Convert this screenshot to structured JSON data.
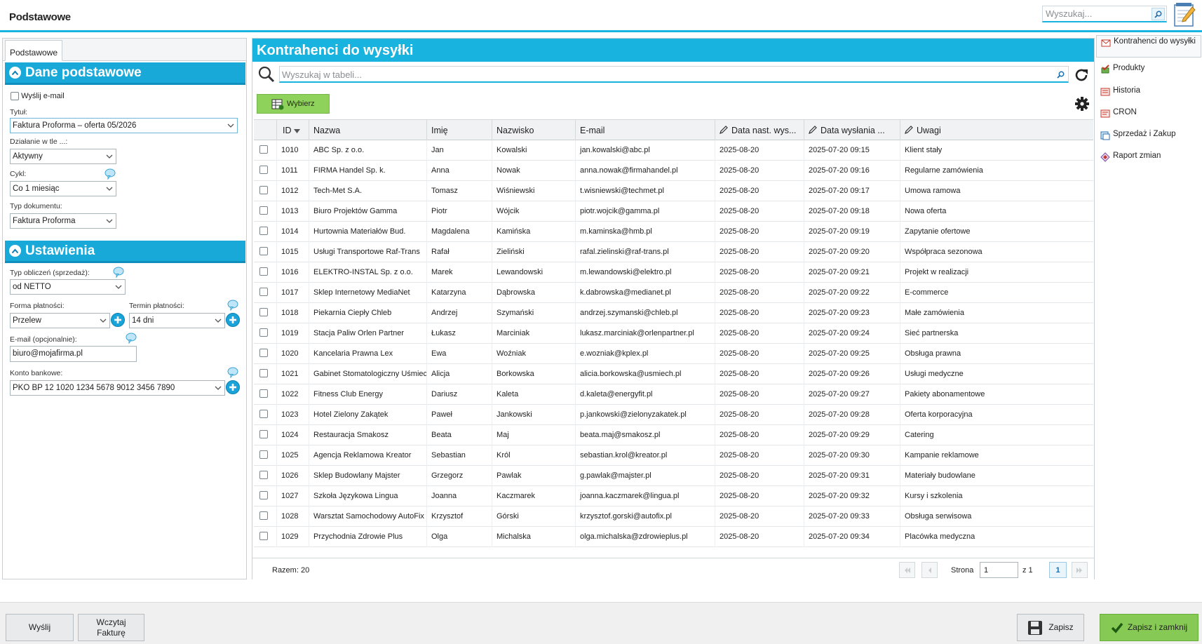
{
  "app": {
    "title": "Podstawowe"
  },
  "global_search": {
    "placeholder": "Wyszukaj..."
  },
  "left_panel": {
    "tab": "Podstawowe",
    "sections": {
      "basic": "Dane podstawowe",
      "settings": "Ustawienia"
    },
    "send_email_label": "Wyślij e-mail",
    "title_label": "Tytuł:",
    "title_value": "Faktura Proforma – oferta 05/2026",
    "background_label": "Działanie w tle ...:",
    "background_value": "Aktywny",
    "cycle_label": "Cykl:",
    "cycle_value": "Co 1 miesiąc",
    "doc_type_label": "Typ dokumentu:",
    "doc_type_value": "Faktura Proforma",
    "calc_type_label": "Typ obliczeń (sprzedaż):",
    "calc_type_value": "od NETTO",
    "payment_form_label": "Forma płatności:",
    "payment_form_value": "Przelew",
    "payment_term_label": "Termin płatności:",
    "payment_term_value": "14 dni",
    "email_opt_label": "E-mail (opcjonalnie):",
    "email_opt_value": "biuro@mojafirma.pl",
    "bank_label": "Konto bankowe:",
    "bank_value": "PKO BP 12 1020 1234 5678 9012 3456 7890"
  },
  "main": {
    "title": "Kontrahenci do wysyłki",
    "search_placeholder": "Wyszukaj w tabeli...",
    "select_button": "Wybierz",
    "columns": [
      "ID",
      "Nazwa",
      "Imię",
      "Nazwisko",
      "E-mail",
      "Data nast. wys...",
      "Data wysłania ...",
      "Uwagi"
    ],
    "rows": [
      {
        "id": "1010",
        "name": "ABC Sp. z o.o.",
        "first": "Jan",
        "last": "Kowalski",
        "email": "jan.kowalski@abc.pl",
        "next": "2025-08-20",
        "sent": "2025-07-20 09:15",
        "notes": "Klient stały"
      },
      {
        "id": "1011",
        "name": "FIRMA Handel Sp. k.",
        "first": "Anna",
        "last": "Nowak",
        "email": "anna.nowak@firmahandel.pl",
        "next": "2025-08-20",
        "sent": "2025-07-20 09:16",
        "notes": "Regularne zamówienia"
      },
      {
        "id": "1012",
        "name": "Tech-Met S.A.",
        "first": "Tomasz",
        "last": "Wiśniewski",
        "email": "t.wisniewski@techmet.pl",
        "next": "2025-08-20",
        "sent": "2025-07-20 09:17",
        "notes": "Umowa ramowa"
      },
      {
        "id": "1013",
        "name": "Biuro Projektów Gamma",
        "first": "Piotr",
        "last": "Wójcik",
        "email": "piotr.wojcik@gamma.pl",
        "next": "2025-08-20",
        "sent": "2025-07-20 09:18",
        "notes": "Nowa oferta"
      },
      {
        "id": "1014",
        "name": "Hurtownia Materiałów Bud.",
        "first": "Magdalena",
        "last": "Kamińska",
        "email": "m.kaminska@hmb.pl",
        "next": "2025-08-20",
        "sent": "2025-07-20 09:19",
        "notes": "Zapytanie ofertowe"
      },
      {
        "id": "1015",
        "name": "Usługi Transportowe Raf-Trans",
        "first": "Rafał",
        "last": "Zieliński",
        "email": "rafal.zielinski@raf-trans.pl",
        "next": "2025-08-20",
        "sent": "2025-07-20 09:20",
        "notes": "Współpraca sezonowa"
      },
      {
        "id": "1016",
        "name": "ELEKTRO-INSTAL Sp. z o.o.",
        "first": "Marek",
        "last": "Lewandowski",
        "email": "m.lewandowski@elektro.pl",
        "next": "2025-08-20",
        "sent": "2025-07-20 09:21",
        "notes": "Projekt w realizacji"
      },
      {
        "id": "1017",
        "name": "Sklep Internetowy MediaNet",
        "first": "Katarzyna",
        "last": "Dąbrowska",
        "email": "k.dabrowska@medianet.pl",
        "next": "2025-08-20",
        "sent": "2025-07-20 09:22",
        "notes": "E-commerce"
      },
      {
        "id": "1018",
        "name": "Piekarnia Ciepły Chleb",
        "first": "Andrzej",
        "last": "Szymański",
        "email": "andrzej.szymanski@chleb.pl",
        "next": "2025-08-20",
        "sent": "2025-07-20 09:23",
        "notes": "Małe zamówienia"
      },
      {
        "id": "1019",
        "name": "Stacja Paliw Orlen Partner",
        "first": "Łukasz",
        "last": "Marciniak",
        "email": "lukasz.marciniak@orlenpartner.pl",
        "next": "2025-08-20",
        "sent": "2025-07-20 09:24",
        "notes": "Sieć partnerska"
      },
      {
        "id": "1020",
        "name": "Kancelaria Prawna Lex",
        "first": "Ewa",
        "last": "Woźniak",
        "email": "e.wozniak@kplex.pl",
        "next": "2025-08-20",
        "sent": "2025-07-20 09:25",
        "notes": "Obsługa prawna"
      },
      {
        "id": "1021",
        "name": "Gabinet Stomatologiczny Uśmiech",
        "first": "Alicja",
        "last": "Borkowska",
        "email": "alicia.borkowska@usmiech.pl",
        "next": "2025-08-20",
        "sent": "2025-07-20 09:26",
        "notes": "Usługi medyczne"
      },
      {
        "id": "1022",
        "name": "Fitness Club Energy",
        "first": "Dariusz",
        "last": "Kaleta",
        "email": "d.kaleta@energyfit.pl",
        "next": "2025-08-20",
        "sent": "2025-07-20 09:27",
        "notes": "Pakiety abonamentowe"
      },
      {
        "id": "1023",
        "name": "Hotel Zielony Zakątek",
        "first": "Paweł",
        "last": "Jankowski",
        "email": "p.jankowski@zielonyzakatek.pl",
        "next": "2025-08-20",
        "sent": "2025-07-20 09:28",
        "notes": "Oferta korporacyjna"
      },
      {
        "id": "1024",
        "name": "Restauracja Smakosz",
        "first": "Beata",
        "last": "Maj",
        "email": "beata.maj@smakosz.pl",
        "next": "2025-08-20",
        "sent": "2025-07-20 09:29",
        "notes": "Catering"
      },
      {
        "id": "1025",
        "name": "Agencja Reklamowa Kreator",
        "first": "Sebastian",
        "last": "Król",
        "email": "sebastian.krol@kreator.pl",
        "next": "2025-08-20",
        "sent": "2025-07-20 09:30",
        "notes": "Kampanie reklamowe"
      },
      {
        "id": "1026",
        "name": "Sklep Budowlany Majster",
        "first": "Grzegorz",
        "last": "Pawlak",
        "email": "g.pawlak@majster.pl",
        "next": "2025-08-20",
        "sent": "2025-07-20 09:31",
        "notes": "Materiały budowlane"
      },
      {
        "id": "1027",
        "name": "Szkoła Językowa Lingua",
        "first": "Joanna",
        "last": "Kaczmarek",
        "email": "joanna.kaczmarek@lingua.pl",
        "next": "2025-08-20",
        "sent": "2025-07-20 09:32",
        "notes": "Kursy i szkolenia"
      },
      {
        "id": "1028",
        "name": "Warsztat Samochodowy AutoFix",
        "first": "Krzysztof",
        "last": "Górski",
        "email": "krzysztof.gorski@autofix.pl",
        "next": "2025-08-20",
        "sent": "2025-07-20 09:33",
        "notes": "Obsługa serwisowa"
      },
      {
        "id": "1029",
        "name": "Przychodnia Zdrowie Plus",
        "first": "Olga",
        "last": "Michalska",
        "email": "olga.michalska@zdrowieplus.pl",
        "next": "2025-08-20",
        "sent": "2025-07-20 09:34",
        "notes": "Placówka medyczna"
      }
    ],
    "total": "Razem: 20",
    "page_label": "Strona",
    "page_value": "1",
    "page_of": "z 1",
    "page_current": "1"
  },
  "right_nav": {
    "items": [
      "Kontrahenci do wysyłki",
      "Produkty",
      "Historia",
      "CRON",
      "Sprzedaż i Zakup",
      "Raport zmian"
    ]
  },
  "bottom": {
    "send": "Wyślij",
    "load_invoice": "Wczytaj Fakturę",
    "save": "Zapisz",
    "save_close": "Zapisz i zamknij"
  },
  "colors": {
    "accent": "#19b3df",
    "button_green": "#86c954",
    "select_green": "#8ed15b"
  }
}
